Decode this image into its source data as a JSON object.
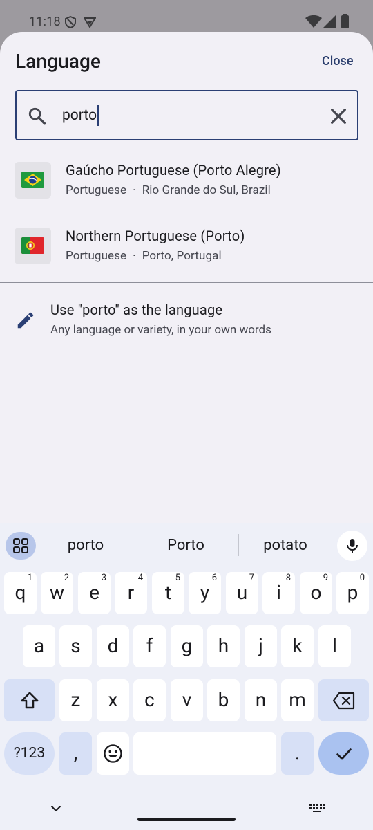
{
  "status_bar": {
    "time": "11:18",
    "icons": [
      "shield-icon",
      "vpn-icon",
      "wifi-icon",
      "cellular-signal-icon",
      "battery-icon"
    ]
  },
  "sheet": {
    "title": "Language",
    "close_label": "Close"
  },
  "search": {
    "value": "porto",
    "icons": [
      "search-icon",
      "clear-icon"
    ]
  },
  "results": [
    {
      "title": "Gaúcho Portuguese (Porto Alegre)",
      "language": "Portuguese",
      "region": "Rio Grande do Sul, Brazil",
      "flag": "brazil-flag-icon"
    },
    {
      "title": "Northern Portuguese (Porto)",
      "language": "Portuguese",
      "region": "Porto, Portugal",
      "flag": "portugal-flag-icon"
    }
  ],
  "separator": "·",
  "custom_entry": {
    "title": "Use \"porto\" as the language",
    "subtitle": "Any language or variety, in your own words",
    "icon": "pencil-icon"
  },
  "keyboard": {
    "suggestions": [
      "porto",
      "Porto",
      "potato"
    ],
    "row1": [
      {
        "key": "q",
        "hint": "1"
      },
      {
        "key": "w",
        "hint": "2"
      },
      {
        "key": "e",
        "hint": "3"
      },
      {
        "key": "r",
        "hint": "4"
      },
      {
        "key": "t",
        "hint": "5"
      },
      {
        "key": "y",
        "hint": "6"
      },
      {
        "key": "u",
        "hint": "7"
      },
      {
        "key": "i",
        "hint": "8"
      },
      {
        "key": "o",
        "hint": "9"
      },
      {
        "key": "p",
        "hint": "0"
      }
    ],
    "row2": [
      "a",
      "s",
      "d",
      "f",
      "g",
      "h",
      "j",
      "k",
      "l"
    ],
    "row3": [
      "z",
      "x",
      "c",
      "v",
      "b",
      "n",
      "m"
    ],
    "symbols_label": "?123",
    "comma": ",",
    "period": ".",
    "colors": {
      "accent": "#2b3f74",
      "modifier_key": "#d7e0f6",
      "enter_key": "#aac2f0"
    }
  }
}
